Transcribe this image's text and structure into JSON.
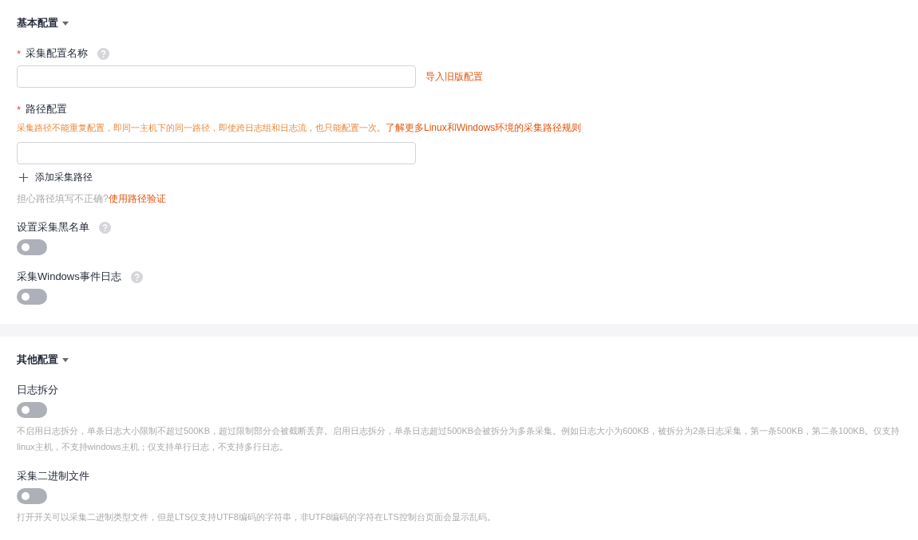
{
  "sections": [
    {
      "title": "基本配置",
      "expanded": true,
      "fields": [
        {
          "kind": "input",
          "label": "采集配置名称",
          "required_mark": "*",
          "help": true,
          "link": "导入旧版配置"
        },
        {
          "kind": "path",
          "label": "路径配置",
          "required_mark": "*",
          "help": false,
          "warning": "采集路径不能重复配置，即同一主机下的同一路径，即使跨日志组和日志流，也只能配置一次。",
          "warning_link": "了解更多Linux和Windows环境的采集路径规则",
          "add_button": "添加采集路径",
          "hint": "担心路径填写不正确?",
          "hint_link": "使用路径验证"
        },
        {
          "kind": "switch",
          "label": "设置采集黑名单",
          "help": true,
          "on": false
        },
        {
          "kind": "switch",
          "label": "采集Windows事件日志",
          "help": true,
          "on": false
        }
      ]
    },
    {
      "title": "其他配置",
      "expanded": true,
      "fields": [
        {
          "kind": "switch",
          "label": "日志拆分",
          "help": false,
          "on": false,
          "description": "不启用日志拆分，单条日志大小限制不超过500KB，超过限制部分会被截断丢弃。启用日志拆分，单条日志超过500KB会被拆分为多条采集。例如日志大小为600KB，被拆分为2条日志采集，第一条500KB，第二条100KB。仅支持linux主机，不支持windows主机；仅支持单行日志，不支持多行日志。"
        },
        {
          "kind": "switch",
          "label": "采集二进制文件",
          "help": false,
          "on": false,
          "description": "打开开关可以采集二进制类型文件，但是LTS仅支持UTF8编码的字符串，非UTF8编码的字符在LTS控制台页面会显示乱码。"
        }
      ]
    }
  ]
}
